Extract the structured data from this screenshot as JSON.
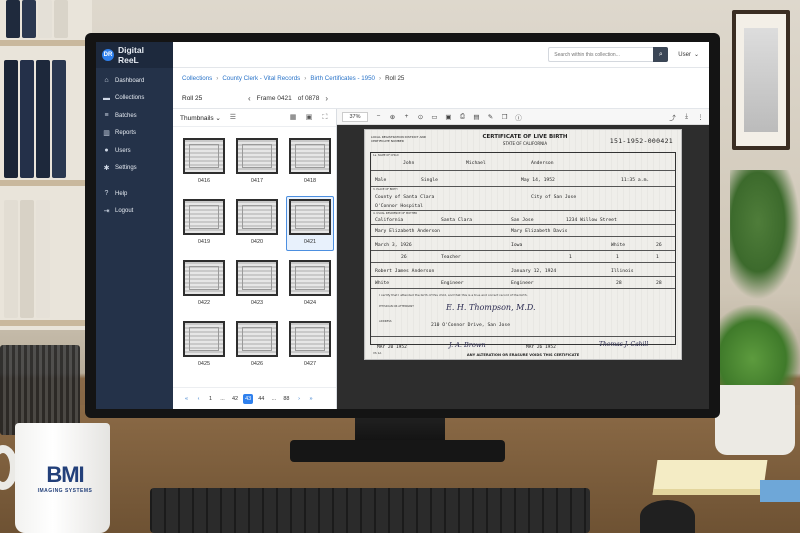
{
  "app": {
    "brand": "Digital ReeL",
    "logo_text": "DR"
  },
  "sidebar": {
    "items": [
      {
        "label": "Dashboard",
        "icon": "home-icon"
      },
      {
        "label": "Collections",
        "icon": "folder-icon"
      },
      {
        "label": "Batches",
        "icon": "stack-icon"
      },
      {
        "label": "Reports",
        "icon": "chart-icon"
      },
      {
        "label": "Users",
        "icon": "users-icon"
      },
      {
        "label": "Settings",
        "icon": "gear-icon"
      },
      {
        "label": "Help",
        "icon": "help-icon"
      },
      {
        "label": "Logout",
        "icon": "logout-icon"
      }
    ]
  },
  "topbar": {
    "search_placeholder": "Search within this collection...",
    "user_label": "User"
  },
  "breadcrumb": {
    "items": [
      "Collections",
      "County Clerk - Vital Records",
      "Birth Certificates - 1950"
    ],
    "current": "Roll 25"
  },
  "roll": {
    "title": "Roll 25",
    "frame_label": "Frame 0421",
    "of_label": "of 0878"
  },
  "thumbnails": {
    "header": "Thumbnails",
    "items": [
      "0416",
      "0417",
      "0418",
      "0419",
      "0420",
      "0421",
      "0422",
      "0423",
      "0424",
      "0425",
      "0426",
      "0427"
    ],
    "selected": "0421"
  },
  "pager": {
    "pages": [
      "1",
      "...",
      "42",
      "43",
      "44",
      "...",
      "88"
    ],
    "current": "43"
  },
  "viewer": {
    "zoom": "37%"
  },
  "certificate": {
    "district_label": "LOCAL REGISTRATION DISTRICT AND CERTIFICATE NUMBER",
    "title": "CERTIFICATE OF LIVE BIRTH",
    "state": "STATE OF CALIFORNIA",
    "number": "151-1952-000421",
    "first_name": "John",
    "middle_name": "Michael",
    "last_name": "Anderson",
    "sex": "Male",
    "birth_type": "Single",
    "birth_date": "May 14, 1952",
    "birth_time": "11:35 a.m.",
    "county": "County of Santa Clara",
    "city": "City of San Jose",
    "hospital": "O'Connor Hospital",
    "mother_state": "California",
    "mother_county": "Santa Clara",
    "mother_city": "San Jose",
    "mother_street": "1234 Willow Street",
    "mother_name": "Mary Elizabeth Anderson",
    "mother_maiden": "Mary Elizabeth Davis",
    "mother_dob": "March 3, 1926",
    "mother_birthplace": "Iowa",
    "mother_color": "White",
    "mother_age": "26",
    "mother_occupation": "Teacher",
    "children_living": "1",
    "children_alive": "1",
    "children_dead": "1",
    "mother_age2": "26",
    "father_name": "Robert James Anderson",
    "father_dob": "January 12, 1924",
    "father_birthplace": "Illinois",
    "father_color": "White",
    "father_occupation": "Engineer",
    "father_age": "28",
    "father_age2": "28",
    "attest": "I certify that I attended the birth of this child, and that this is a true and correct record of the birth.",
    "physician_label": "PHYSICIAN OR ATTENDANT",
    "physician_signature": "E. H. Thompson, M.D.",
    "address_label": "ADDRESS",
    "address": "210 O'Connor Drive, San Jose",
    "filed_date": "MAY 20 1952",
    "registrar_signature": "J. A. Brown",
    "accepted_date": "MAY 26 1952",
    "state_registrar_signature": "Thomas J. Cahill",
    "footer": "ANY ALTERATION OR ERASURE VOIDS THIS CERTIFICATE",
    "form_no": "VS 1A"
  },
  "mug": {
    "brand": "BMI",
    "tagline": "IMAGING SYSTEMS"
  },
  "colors": {
    "sidebar": "#243249",
    "accent": "#2f80ed",
    "link": "#2a74c9"
  }
}
